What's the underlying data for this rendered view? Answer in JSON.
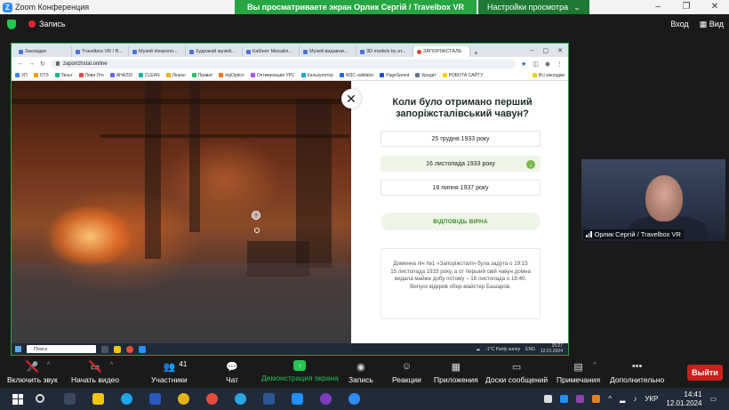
{
  "zoom_window": {
    "title": "Zoom Конференция",
    "share_banner": "Вы просматриваете экран Орлик Сергій / Travelbox VR",
    "view_options": "Настройки просмотра",
    "recording": "Запись",
    "view_enter": "Вход",
    "view_mode": "Вид"
  },
  "browser": {
    "tabs": [
      {
        "label": "Закладки"
      },
      {
        "label": "Travelbox VR / В..."
      },
      {
        "label": "Музей Некропо..."
      },
      {
        "label": "Художній музей..."
      },
      {
        "label": "Кабінет Михайл..."
      },
      {
        "label": "Музей видавни..."
      },
      {
        "label": "3D models by ат..."
      },
      {
        "label": "ЗАПОРІЖСТАЛЬ"
      }
    ],
    "url": "zaporizhstal.online",
    "bookmarks": [
      "УП",
      "ОТЗ",
      "Тиньт",
      "Лови Лто",
      "АНАЛІЗ",
      "CLEAN",
      "Лінкан",
      "Приват",
      "ingOption",
      "Оптимизация УРС",
      "Калькулятор",
      "W3C validator",
      "PageSpeed",
      "Кредит",
      "РОБОТА САЙТУ"
    ],
    "bookmarks_all": "Всі закладки"
  },
  "quiz": {
    "question": "Коли було отримано перший запоріжсталівський чавун?",
    "options": [
      "25 грудня 1933 року",
      "16 листопада 1933 року",
      "18 липня 1937 року"
    ],
    "answer_label": "ВІДПОВІДЬ ВІРНА",
    "info": "Доменна піч №1 «Запоріжсталі» була задута о 19:15 15 листопада 1933 року, а от перший свій чавун домна видала майже добу потому – 16 листопада о 18:40. Випуск відкрив обер-майстер Башаров."
  },
  "inner_taskbar": {
    "search": "Поиск",
    "weather": "-1°C Partly sunny",
    "lang": "ENG",
    "time": "15:27",
    "date": "12.01.2024"
  },
  "participant": {
    "name": "Орлик Сергій / Travelbox VR"
  },
  "toolbar": {
    "mute": "Включить звук",
    "video": "Начать видео",
    "participants": "Участники",
    "participants_count": "41",
    "chat": "Чат",
    "share": "Демонстрация экрана",
    "record": "Запись",
    "reactions": "Реакции",
    "apps": "Приложения",
    "whiteboards": "Доски сообщений",
    "notes": "Примечания",
    "more": "Дополнительно",
    "leave": "Выйти"
  },
  "taskbar": {
    "lang": "УКР",
    "time": "14:41",
    "date": "12.01.2024"
  }
}
